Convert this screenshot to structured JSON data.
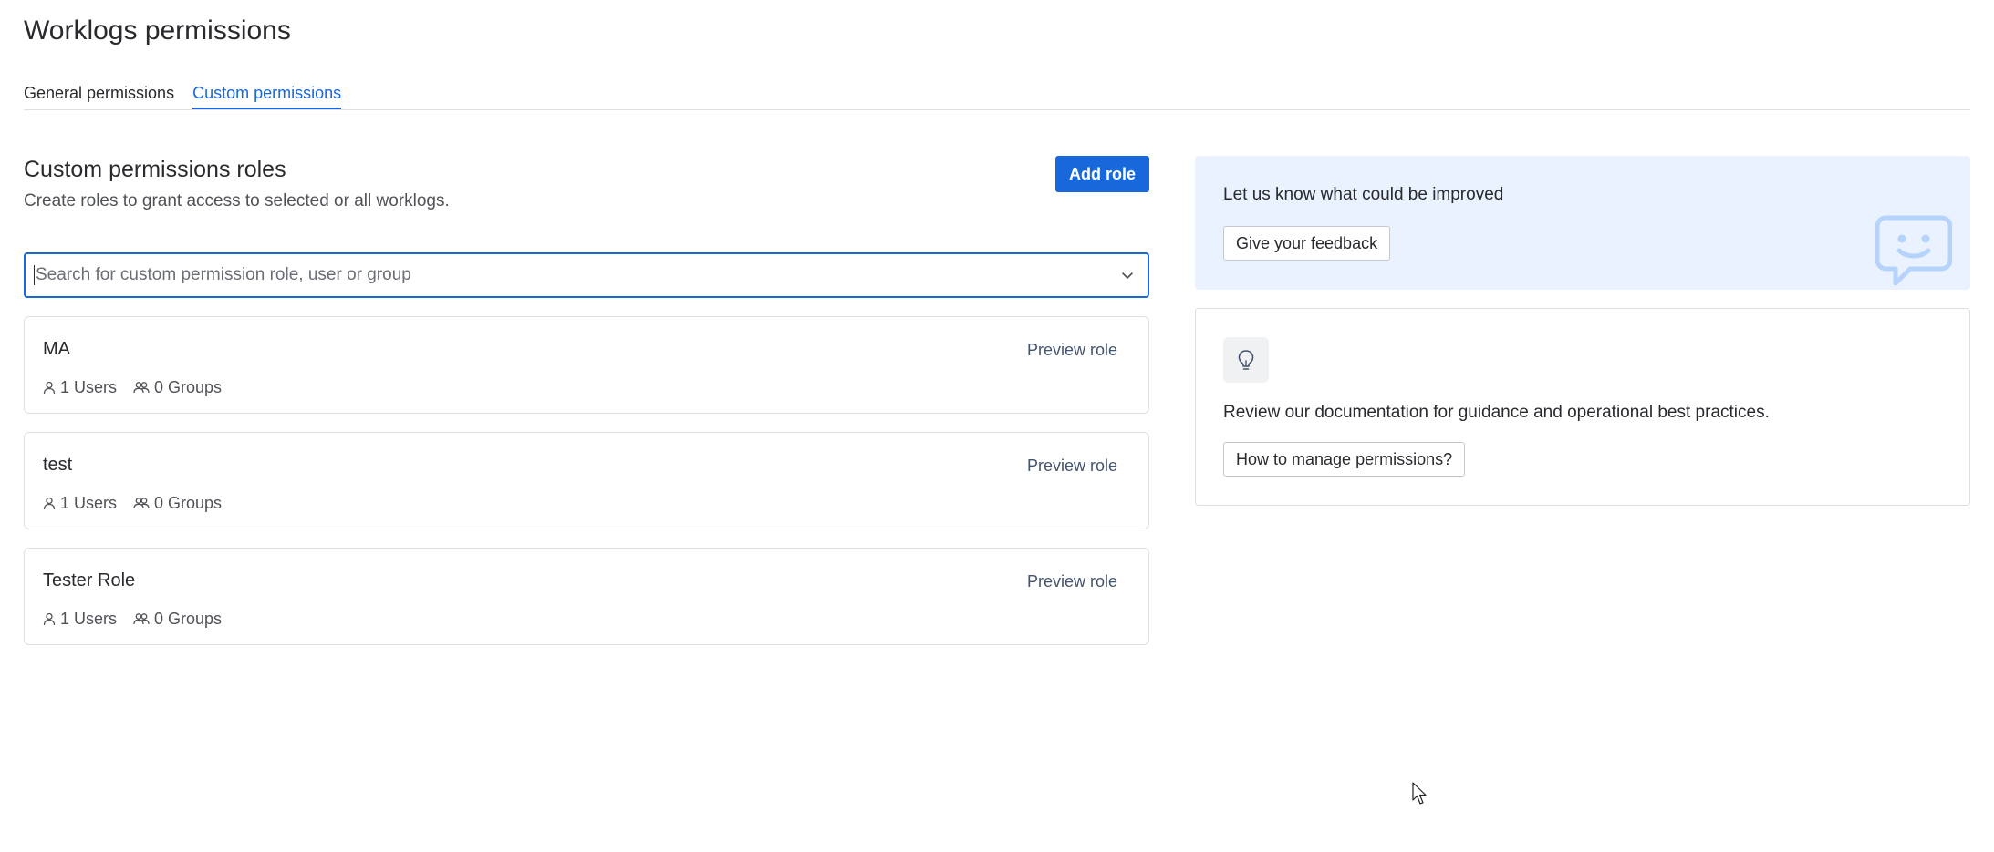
{
  "page": {
    "title": "Worklogs permissions"
  },
  "tabs": [
    {
      "label": "General permissions",
      "active": false
    },
    {
      "label": "Custom permissions",
      "active": true
    }
  ],
  "roles_section": {
    "title": "Custom permissions roles",
    "description": "Create roles to grant access to selected or all worklogs.",
    "add_button": "Add role",
    "search_placeholder": "Search for custom permission role, user or group",
    "search_value": ""
  },
  "roles": [
    {
      "name": "MA",
      "preview_label": "Preview role",
      "users": "1 Users",
      "groups": "0 Groups"
    },
    {
      "name": "test",
      "preview_label": "Preview role",
      "users": "1 Users",
      "groups": "0 Groups"
    },
    {
      "name": "Tester Role",
      "preview_label": "Preview role",
      "users": "1 Users",
      "groups": "0 Groups"
    }
  ],
  "feedback": {
    "title": "Let us know what could be improved",
    "button": "Give your feedback",
    "icon": "feedback-chat-icon"
  },
  "docs": {
    "icon": "lightbulb-icon",
    "text": "Review our documentation for guidance and operational best practices.",
    "button": "How to manage permissions?"
  },
  "colors": {
    "accent": "#1868db",
    "feedback_bg": "#e9f2fe",
    "border": "#dcdfe4",
    "text": "#292a2e",
    "subtle_text": "#505258"
  }
}
